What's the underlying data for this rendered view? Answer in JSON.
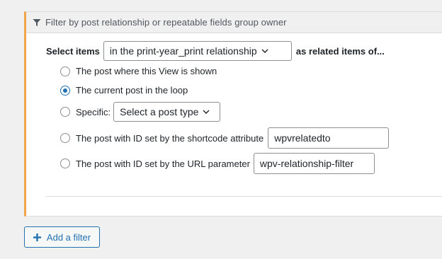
{
  "panel": {
    "header_title": "Filter by post relationship or repeatable fields group owner",
    "header_icon": "funnel-icon",
    "accent_color": "#f0a54b"
  },
  "select_items": {
    "label": "Select items",
    "relationship_value": "in the print-year_print relationship",
    "suffix": "as related items of..."
  },
  "options": [
    {
      "label": "The post where this View is shown",
      "checked": false
    },
    {
      "label": "The current post in the loop",
      "checked": true
    },
    {
      "label": "Specific:",
      "checked": false,
      "select_value": "Select a post type"
    },
    {
      "label": "The post with ID set by the shortcode attribute",
      "checked": false,
      "input_value": "wpvrelatedto"
    },
    {
      "label": "The post with ID set by the URL parameter",
      "checked": false,
      "input_value": "wpv-relationship-filter"
    }
  ],
  "add_filter": {
    "label": "Add a filter",
    "icon": "plus-icon",
    "color": "#2271b1"
  }
}
